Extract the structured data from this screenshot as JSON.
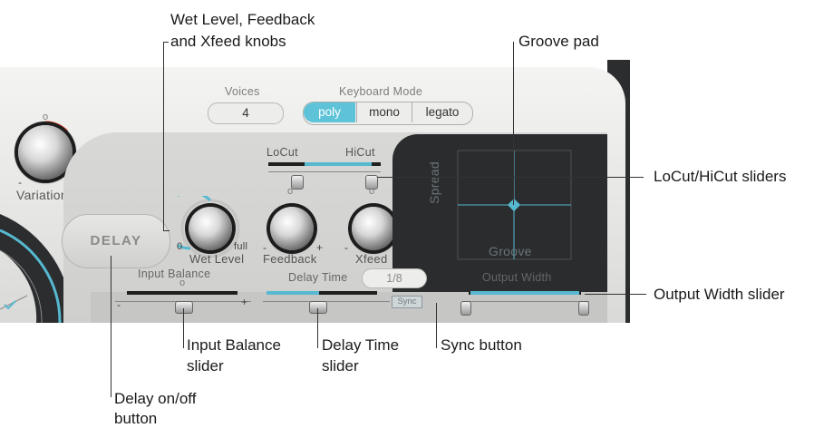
{
  "callouts": {
    "wet_feedback_xfeed_line1": "Wet Level, Feedback",
    "wet_feedback_xfeed_line2": "and Xfeed knobs",
    "groove_pad": "Groove pad",
    "locut_hicut": "LoCut/HiCut sliders",
    "output_width": "Output Width slider",
    "input_balance_line1": "Input Balance",
    "input_balance_line2": "slider",
    "delay_time_line1": "Delay Time",
    "delay_time_line2": "slider",
    "sync_button": "Sync button",
    "delay_onoff_line1": "Delay on/off",
    "delay_onoff_line2": "button"
  },
  "plugin": {
    "voices": {
      "label": "Voices",
      "value": "4"
    },
    "keyboard_mode": {
      "label": "Keyboard Mode",
      "options": [
        "poly",
        "mono",
        "legato"
      ],
      "selected": "poly"
    },
    "variation": {
      "label": "Variation",
      "minus": "-",
      "plus": "+",
      "indicator": "o"
    },
    "delay_button": "DELAY",
    "locut_label": "LoCut",
    "hicut_label": "HiCut",
    "wet_level": {
      "label": "Wet Level",
      "min": "0",
      "max": "full"
    },
    "feedback": {
      "label": "Feedback",
      "minus": "-",
      "plus": "+",
      "indicator": "o"
    },
    "xfeed": {
      "label": "Xfeed",
      "minus": "-",
      "plus": "+",
      "indicator": "o"
    },
    "groove_pad": {
      "x_label": "Groove",
      "y_label": "Spread"
    },
    "input_balance": {
      "label": "Input Balance",
      "minus": "-",
      "plus": "+",
      "indicator": "o"
    },
    "delay_time": {
      "label": "Delay Time",
      "value": "1/8"
    },
    "sync": "Sync",
    "output_width": {
      "label": "Output Width"
    }
  },
  "colors": {
    "accent_blue": "#56b9cf",
    "selected_segment": "#5ec3d8",
    "pad_background": "#2a2c2e",
    "variation_red": "#d23a1e"
  }
}
